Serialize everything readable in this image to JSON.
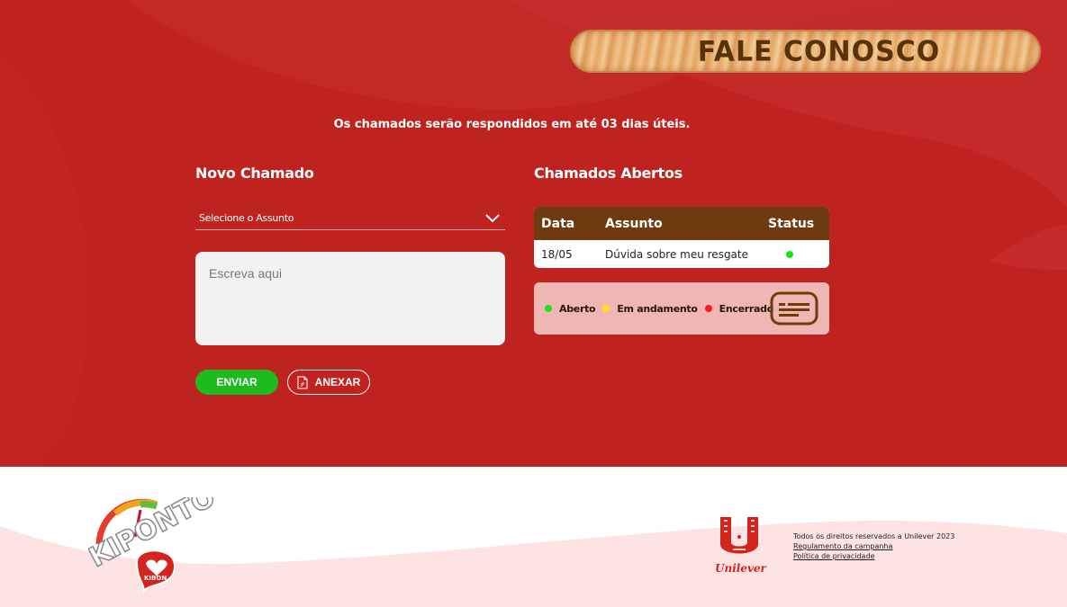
{
  "page": {
    "title": "FALE CONOSCO",
    "notice": "Os chamados serão respondidos em até 03 dias úteis."
  },
  "new_ticket": {
    "title": "Novo Chamado",
    "subject_select": {
      "value": "Selecione o Assunto"
    },
    "message": {
      "placeholder": "Escreva aqui"
    },
    "send_label": "ENVIAR",
    "attach_label": "ANEXAR"
  },
  "open_tickets": {
    "title": "Chamados Abertos",
    "columns": [
      "Data",
      "Assunto",
      "Status"
    ],
    "rows": [
      {
        "date": "18/05",
        "subject": "Dúvida sobre meu resgate",
        "status": "Aberto",
        "status_color": "#19e219"
      }
    ],
    "legend": [
      {
        "label": "Aberto",
        "color": "#19e219"
      },
      {
        "label": "Em andamento",
        "color": "#ffe01a"
      },
      {
        "label": "Encerrado",
        "color": "#ff1a1a"
      }
    ]
  },
  "footer": {
    "brand_logo": "kipontos-kibon-logo",
    "brand_logo_text": "KIPONTOS",
    "brand_logo_badge": "KIBON",
    "unilever_logo": "unilever-logo",
    "unilever_text": "Unilever",
    "copyright": "Todos os direitos reservados a Unilever 2023",
    "links": [
      {
        "label": "Regulamento da campanha"
      },
      {
        "label": "Política de privacidade"
      }
    ]
  },
  "colors": {
    "background_red": "#bf2320",
    "header_brown": "#6e3b0e",
    "button_green": "#1ebb1e",
    "legend_bg": "#f0b6b3"
  }
}
